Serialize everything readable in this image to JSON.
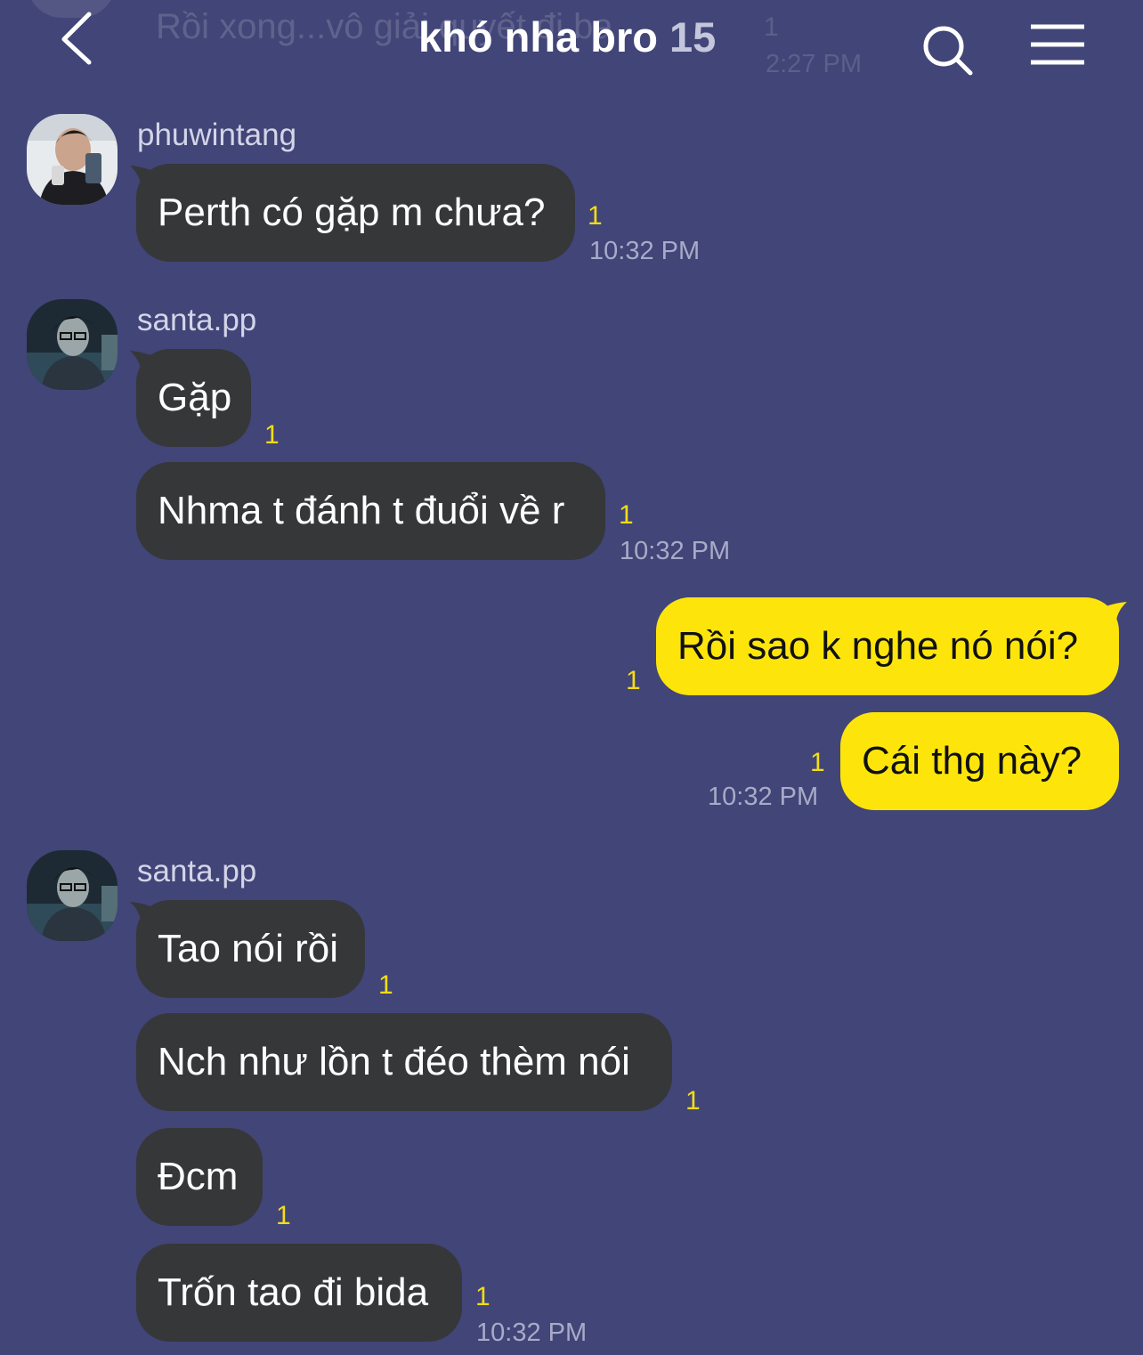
{
  "header": {
    "title": "khó nha bro",
    "member_count": "15",
    "back_icon": "chevron-left-icon",
    "search_icon": "search-icon",
    "menu_icon": "hamburger-menu-icon"
  },
  "ghost_message": {
    "text": "Rồi xong...vô giải quyết đi ba",
    "unread": "1",
    "time": "2:27 PM"
  },
  "colors": {
    "background": "#414577",
    "incoming_bubble": "#363739",
    "outgoing_bubble": "#fde50b",
    "unread_count": "#f6dc16"
  },
  "messages": [
    {
      "sender": "phuwintang",
      "text": "Perth có gặp m chưa?",
      "unread": "1",
      "time": "10:32 PM"
    },
    {
      "sender": "santa.pp",
      "text": "Gặp",
      "unread": "1"
    },
    {
      "sender": "santa.pp",
      "text": "Nhma t đánh t đuổi về r",
      "unread": "1",
      "time": "10:32 PM"
    },
    {
      "sender": "me",
      "text": "Rồi sao k nghe nó nói?",
      "unread": "1"
    },
    {
      "sender": "me",
      "text": "Cái thg này?",
      "unread": "1",
      "time": "10:32 PM"
    },
    {
      "sender": "santa.pp",
      "text": "Tao nói rồi",
      "unread": "1"
    },
    {
      "sender": "santa.pp",
      "text": "Nch như lồn t đéo thèm nói",
      "unread": "1"
    },
    {
      "sender": "santa.pp",
      "text": "Đcm",
      "unread": "1"
    },
    {
      "sender": "santa.pp",
      "text": "Trốn tao đi bida",
      "unread": "1",
      "time": "10:32 PM"
    }
  ]
}
